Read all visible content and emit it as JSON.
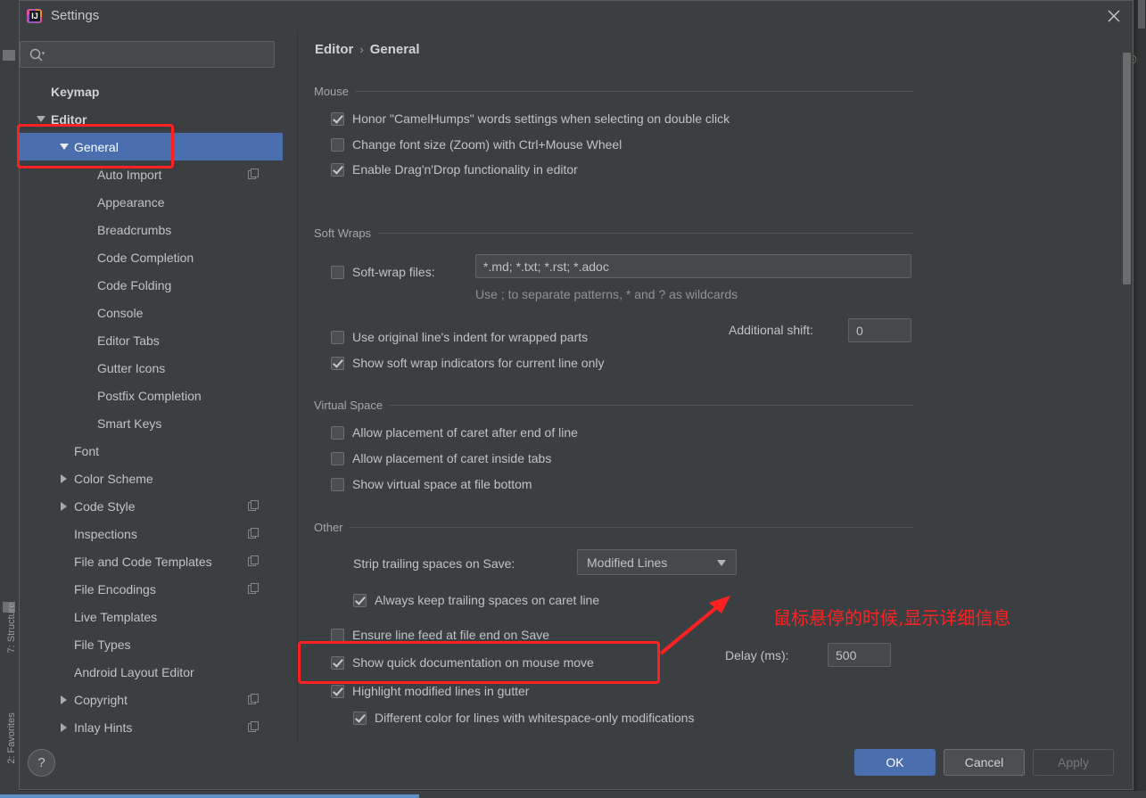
{
  "window": {
    "title": "Settings",
    "logo_icon": "intellij-idea-logo",
    "close_icon": "close-icon"
  },
  "sidebar": {
    "search": {
      "value": "",
      "placeholder": "",
      "icon": "search-icon",
      "dropdown_icon": "chevron-down-icon"
    },
    "items": [
      {
        "label": "Keymap",
        "indent": 0,
        "arrow": "none",
        "bold": true,
        "selected": false,
        "badge": false
      },
      {
        "label": "Editor",
        "indent": 0,
        "arrow": "down",
        "bold": true,
        "selected": false,
        "badge": false
      },
      {
        "label": "General",
        "indent": 1,
        "arrow": "down",
        "bold": false,
        "selected": true,
        "badge": false
      },
      {
        "label": "Auto Import",
        "indent": 2,
        "arrow": "none",
        "bold": false,
        "selected": false,
        "badge": true
      },
      {
        "label": "Appearance",
        "indent": 2,
        "arrow": "none",
        "bold": false,
        "selected": false,
        "badge": false
      },
      {
        "label": "Breadcrumbs",
        "indent": 2,
        "arrow": "none",
        "bold": false,
        "selected": false,
        "badge": false
      },
      {
        "label": "Code Completion",
        "indent": 2,
        "arrow": "none",
        "bold": false,
        "selected": false,
        "badge": false
      },
      {
        "label": "Code Folding",
        "indent": 2,
        "arrow": "none",
        "bold": false,
        "selected": false,
        "badge": false
      },
      {
        "label": "Console",
        "indent": 2,
        "arrow": "none",
        "bold": false,
        "selected": false,
        "badge": false
      },
      {
        "label": "Editor Tabs",
        "indent": 2,
        "arrow": "none",
        "bold": false,
        "selected": false,
        "badge": false
      },
      {
        "label": "Gutter Icons",
        "indent": 2,
        "arrow": "none",
        "bold": false,
        "selected": false,
        "badge": false
      },
      {
        "label": "Postfix Completion",
        "indent": 2,
        "arrow": "none",
        "bold": false,
        "selected": false,
        "badge": false
      },
      {
        "label": "Smart Keys",
        "indent": 2,
        "arrow": "none",
        "bold": false,
        "selected": false,
        "badge": false
      },
      {
        "label": "Font",
        "indent": 1,
        "arrow": "none",
        "bold": false,
        "selected": false,
        "badge": false
      },
      {
        "label": "Color Scheme",
        "indent": 1,
        "arrow": "right",
        "bold": false,
        "selected": false,
        "badge": false
      },
      {
        "label": "Code Style",
        "indent": 1,
        "arrow": "right",
        "bold": false,
        "selected": false,
        "badge": true
      },
      {
        "label": "Inspections",
        "indent": 1,
        "arrow": "none",
        "bold": false,
        "selected": false,
        "badge": true
      },
      {
        "label": "File and Code Templates",
        "indent": 1,
        "arrow": "none",
        "bold": false,
        "selected": false,
        "badge": true
      },
      {
        "label": "File Encodings",
        "indent": 1,
        "arrow": "none",
        "bold": false,
        "selected": false,
        "badge": true
      },
      {
        "label": "Live Templates",
        "indent": 1,
        "arrow": "none",
        "bold": false,
        "selected": false,
        "badge": false
      },
      {
        "label": "File Types",
        "indent": 1,
        "arrow": "none",
        "bold": false,
        "selected": false,
        "badge": false
      },
      {
        "label": "Android Layout Editor",
        "indent": 1,
        "arrow": "none",
        "bold": false,
        "selected": false,
        "badge": false
      },
      {
        "label": "Copyright",
        "indent": 1,
        "arrow": "right",
        "bold": false,
        "selected": false,
        "badge": true
      },
      {
        "label": "Inlay Hints",
        "indent": 1,
        "arrow": "right",
        "bold": false,
        "selected": false,
        "badge": true
      }
    ]
  },
  "breadcrumb": {
    "root": "Editor",
    "separator": "›",
    "leaf": "General"
  },
  "sections": {
    "mouse": {
      "title": "Mouse",
      "options": [
        {
          "label": "Honor \"CamelHumps\" words settings when selecting on double click",
          "checked": true
        },
        {
          "label": "Change font size (Zoom) with Ctrl+Mouse Wheel",
          "checked": false
        },
        {
          "label": "Enable Drag'n'Drop functionality in editor",
          "checked": true
        }
      ]
    },
    "soft_wraps": {
      "title": "Soft Wraps",
      "soft_wrap_files": {
        "label": "Soft-wrap files:",
        "checked": false,
        "value": "*.md; *.txt; *.rst; *.adoc"
      },
      "hint": "Use ; to separate patterns, * and ? as wildcards",
      "use_original_indent": {
        "label": "Use original line's indent for wrapped parts",
        "checked": false
      },
      "additional_shift": {
        "label": "Additional shift:",
        "value": "0"
      },
      "show_indicators": {
        "label": "Show soft wrap indicators for current line only",
        "checked": true
      }
    },
    "virtual_space": {
      "title": "Virtual Space",
      "options": [
        {
          "label": "Allow placement of caret after end of line",
          "checked": false
        },
        {
          "label": "Allow placement of caret inside tabs",
          "checked": false
        },
        {
          "label": "Show virtual space at file bottom",
          "checked": false
        }
      ]
    },
    "other": {
      "title": "Other",
      "strip_trailing": {
        "label": "Strip trailing spaces on Save:",
        "value": "Modified Lines",
        "caret_icon": "chevron-down-icon"
      },
      "always_keep": {
        "label": "Always keep trailing spaces on caret line",
        "checked": true
      },
      "ensure_line_feed": {
        "label": "Ensure line feed at file end on Save",
        "checked": false
      },
      "quick_doc": {
        "label": "Show quick documentation on mouse move",
        "checked": true
      },
      "delay": {
        "label": "Delay (ms):",
        "value": "500"
      },
      "highlight_modified": {
        "label": "Highlight modified lines in gutter",
        "checked": true
      },
      "different_color": {
        "label": "Different color for lines with whitespace-only modifications",
        "checked": true
      }
    }
  },
  "footer": {
    "help_label": "?",
    "ok_label": "OK",
    "cancel_label": "Cancel",
    "apply_label": "Apply"
  },
  "annotation": {
    "note_text": "鼠标悬停的时候,显示详细信息",
    "color": "#ff2121"
  },
  "ide_background": {
    "left_labels": [
      "7: Structure",
      "2: Favorites"
    ]
  }
}
